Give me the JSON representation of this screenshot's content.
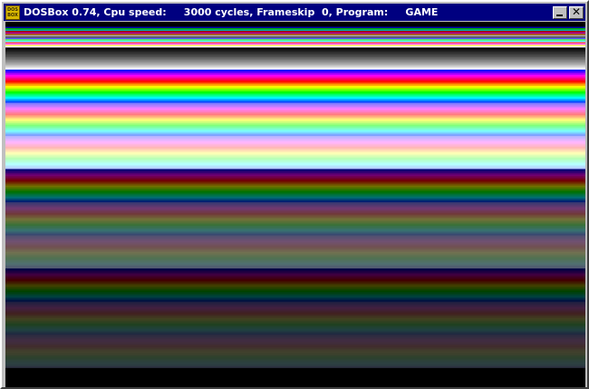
{
  "window": {
    "title": "DOSBox 0.74, Cpu speed:     3000 cycles, Frameskip  0, Program:     GAME",
    "icon_text_top": "DOS",
    "icon_text_bottom": "BOX",
    "minimize_icon": "minimize-icon",
    "close_icon": "close-icon",
    "close_glyph": "✕",
    "titlebar_color": "#000080"
  },
  "screen": {
    "content": "VGA 256-color palette displayed as horizontal stripes"
  }
}
